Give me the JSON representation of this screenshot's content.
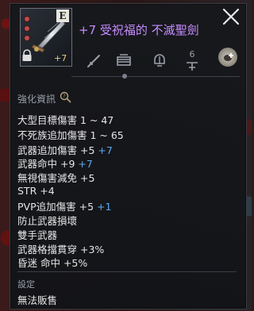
{
  "item": {
    "name": "+7 受祝福的 不滅聖劍",
    "grade": "E",
    "enchant": "+7",
    "category_level": "6"
  },
  "sections": {
    "enhance_title": "強化資訊",
    "settings_title": "設定",
    "not_for_sale": "無法販售"
  },
  "stats": [
    {
      "text": "大型目標傷害 1 ~ 47",
      "bonus": ""
    },
    {
      "text": "不死族追加傷害 1 ~ 65",
      "bonus": ""
    },
    {
      "text": "武器追加傷害 +5",
      "bonus": "+7"
    },
    {
      "text": "武器命中 +9",
      "bonus": "+7"
    },
    {
      "text": "無視傷害減免 +5",
      "bonus": ""
    },
    {
      "text": "STR +4",
      "bonus": ""
    },
    {
      "text": "PVP追加傷害 +5",
      "bonus": "+1"
    },
    {
      "text": "防止武器損壞",
      "bonus": ""
    },
    {
      "text": "雙手武器",
      "bonus": ""
    },
    {
      "text": "武器格擋貫穿 +3%",
      "bonus": ""
    },
    {
      "text": "昏迷 命中 +5%",
      "bonus": ""
    }
  ],
  "icons": {
    "close": "close-icon",
    "info": "magnify-info-icon",
    "lock": "lock-icon",
    "socket": "add-socket-icon",
    "categories": [
      "sword-class-icon",
      "storage-chest-icon",
      "helmet-icon",
      "level-icon"
    ]
  },
  "colors": {
    "item_name": "#c88cff",
    "bonus": "#5ba8f0",
    "stat_text": "#e6e6e6",
    "section_title": "#9aa0a8"
  }
}
